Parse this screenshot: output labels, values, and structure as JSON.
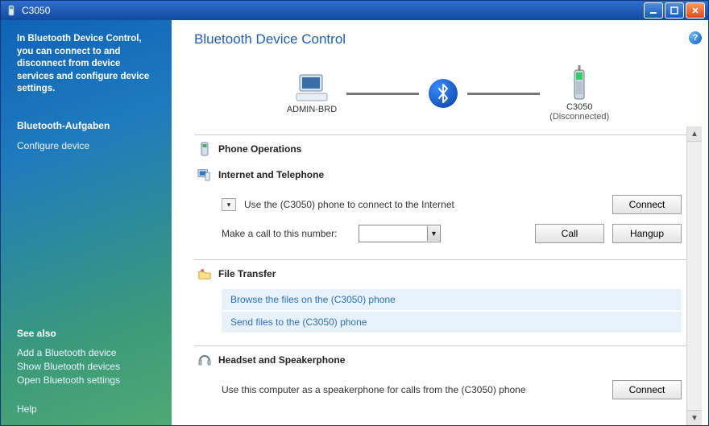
{
  "window": {
    "title": "C3050"
  },
  "sidebar": {
    "intro": "In Bluetooth Device Control, you can connect to and disconnect from device services and configure device settings.",
    "tasks_heading": "Bluetooth-Aufgaben",
    "tasks": {
      "configure": "Configure device"
    },
    "see_also_heading": "See also",
    "see_also": {
      "add": "Add a Bluetooth device",
      "show": "Show Bluetooth devices",
      "open": "Open Bluetooth settings"
    },
    "help": "Help"
  },
  "page": {
    "title": "Bluetooth Device Control"
  },
  "diagram": {
    "local_name": "ADMIN-BRD",
    "remote_name": "C3050",
    "remote_status": "(Disconnected)"
  },
  "sections": {
    "phone_ops": {
      "title": "Phone Operations"
    },
    "internet": {
      "title": "Internet and Telephone",
      "use_phone_text": "Use the (C3050) phone to connect to the Internet",
      "connect_btn": "Connect",
      "make_call_label": "Make a call to this number:",
      "call_btn": "Call",
      "hangup_btn": "Hangup",
      "number_value": ""
    },
    "file_transfer": {
      "title": "File Transfer",
      "browse_link": "Browse the files on the (C3050) phone",
      "send_link": "Send files to the (C3050) phone"
    },
    "headset": {
      "title": "Headset and Speakerphone",
      "desc": "Use this computer as a speakerphone for calls from the (C3050) phone",
      "connect_btn": "Connect"
    }
  }
}
